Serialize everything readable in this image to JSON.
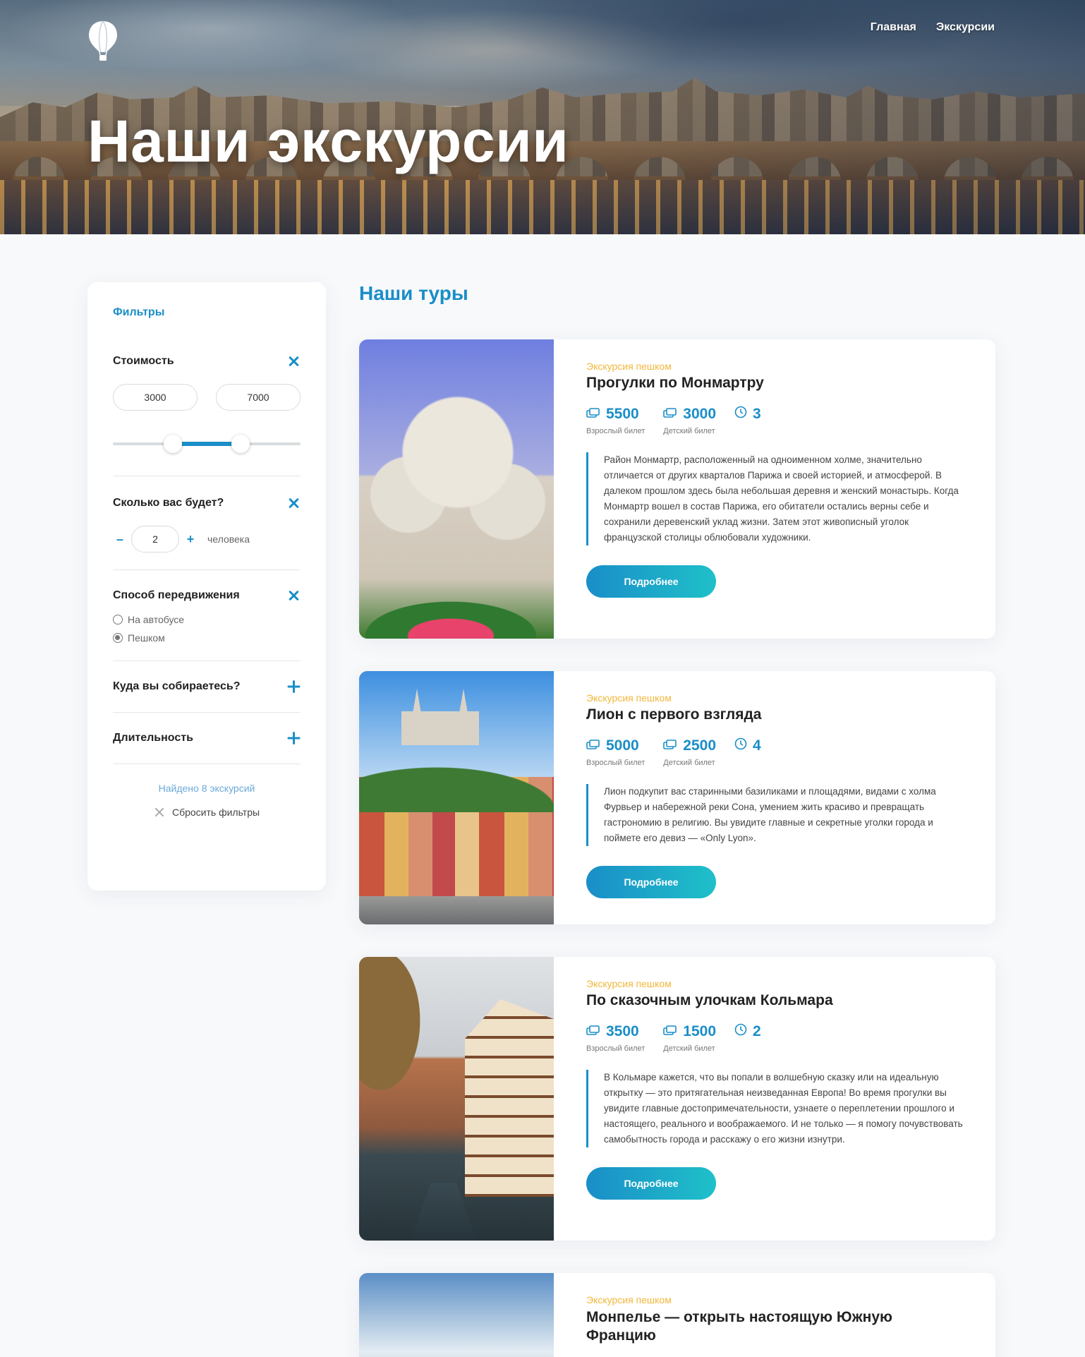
{
  "nav": {
    "items": [
      "Главная",
      "Экскурсии"
    ]
  },
  "hero": {
    "title": "Наши экскурсии",
    "logo": "balloon-icon"
  },
  "filters": {
    "title": "Фильтры",
    "price": {
      "label": "Стоимость",
      "min": "3000",
      "max": "7000",
      "range_fraction": [
        0.32,
        0.68
      ]
    },
    "people": {
      "label": "Сколько вас будет?",
      "value": "2",
      "unit": "человека",
      "minus": "–",
      "plus": "+"
    },
    "transport": {
      "label": "Способ передвижения",
      "options": [
        "На автобусе",
        "Пешком"
      ],
      "selected": "Пешком"
    },
    "destination": {
      "label": "Куда вы собираетесь?"
    },
    "duration": {
      "label": "Длительность"
    },
    "found": "Найдено 8 экскурсий",
    "reset": "Сбросить фильтры"
  },
  "main": {
    "title": "Наши туры",
    "tours": [
      {
        "type": "Экскурсия пешком",
        "title": "Прогулки по Монмартру",
        "adult_price": "5500",
        "child_price": "3000",
        "hours": "3",
        "adult_label": "Взрослый билет",
        "child_label": "Детский билет",
        "description": "Район Монмартр, расположенный на одноименном холме, значительно отличается от других кварталов Парижа и своей историей, и атмосферой. В далеком прошлом здесь была небольшая деревня и женский монастырь. Когда Монмартр вошел в состав Парижа, его обитатели остались верны себе и сохранили деревенский уклад жизни. Затем этот живописный уголок французской столицы облюбовали художники.",
        "button": "Подробнее"
      },
      {
        "type": "Экскурсия пешком",
        "title": "Лион с первого взгляда",
        "adult_price": "5000",
        "child_price": "2500",
        "hours": "4",
        "adult_label": "Взрослый билет",
        "child_label": "Детский билет",
        "description": "Лион подкупит вас старинными базиликами и площадями, видами с холма Фурвьер и набережной реки Сона, умением жить красиво и превращать гастрономию в религию. Вы увидите главные и секретные уголки города и поймете его девиз — «Only Lyon».",
        "button": "Подробнее"
      },
      {
        "type": "Экскурсия пешком",
        "title": "По сказочным улочкам Кольмара",
        "adult_price": "3500",
        "child_price": "1500",
        "hours": "2",
        "adult_label": "Взрослый билет",
        "child_label": "Детский билет",
        "description": "В Кольмаре кажется, что вы попали в волшебную сказку или на идеальную открытку — это притягательная неизведанная Европа! Во время прогулки вы увидите главные достопримечательности, узнаете о переплетении прошлого и настоящего, реального и воображаемого. И не только — я помогу почувствовать самобытность города и расскажу о его жизни изнутри.",
        "button": "Подробнее"
      },
      {
        "type": "Экскурсия пешком",
        "title": "Монпелье — открыть настоящую Южную Францию"
      }
    ]
  },
  "colors": {
    "accent": "#1a8ec8",
    "accent2": "#1fc0c9",
    "tag": "#f2b73b"
  }
}
